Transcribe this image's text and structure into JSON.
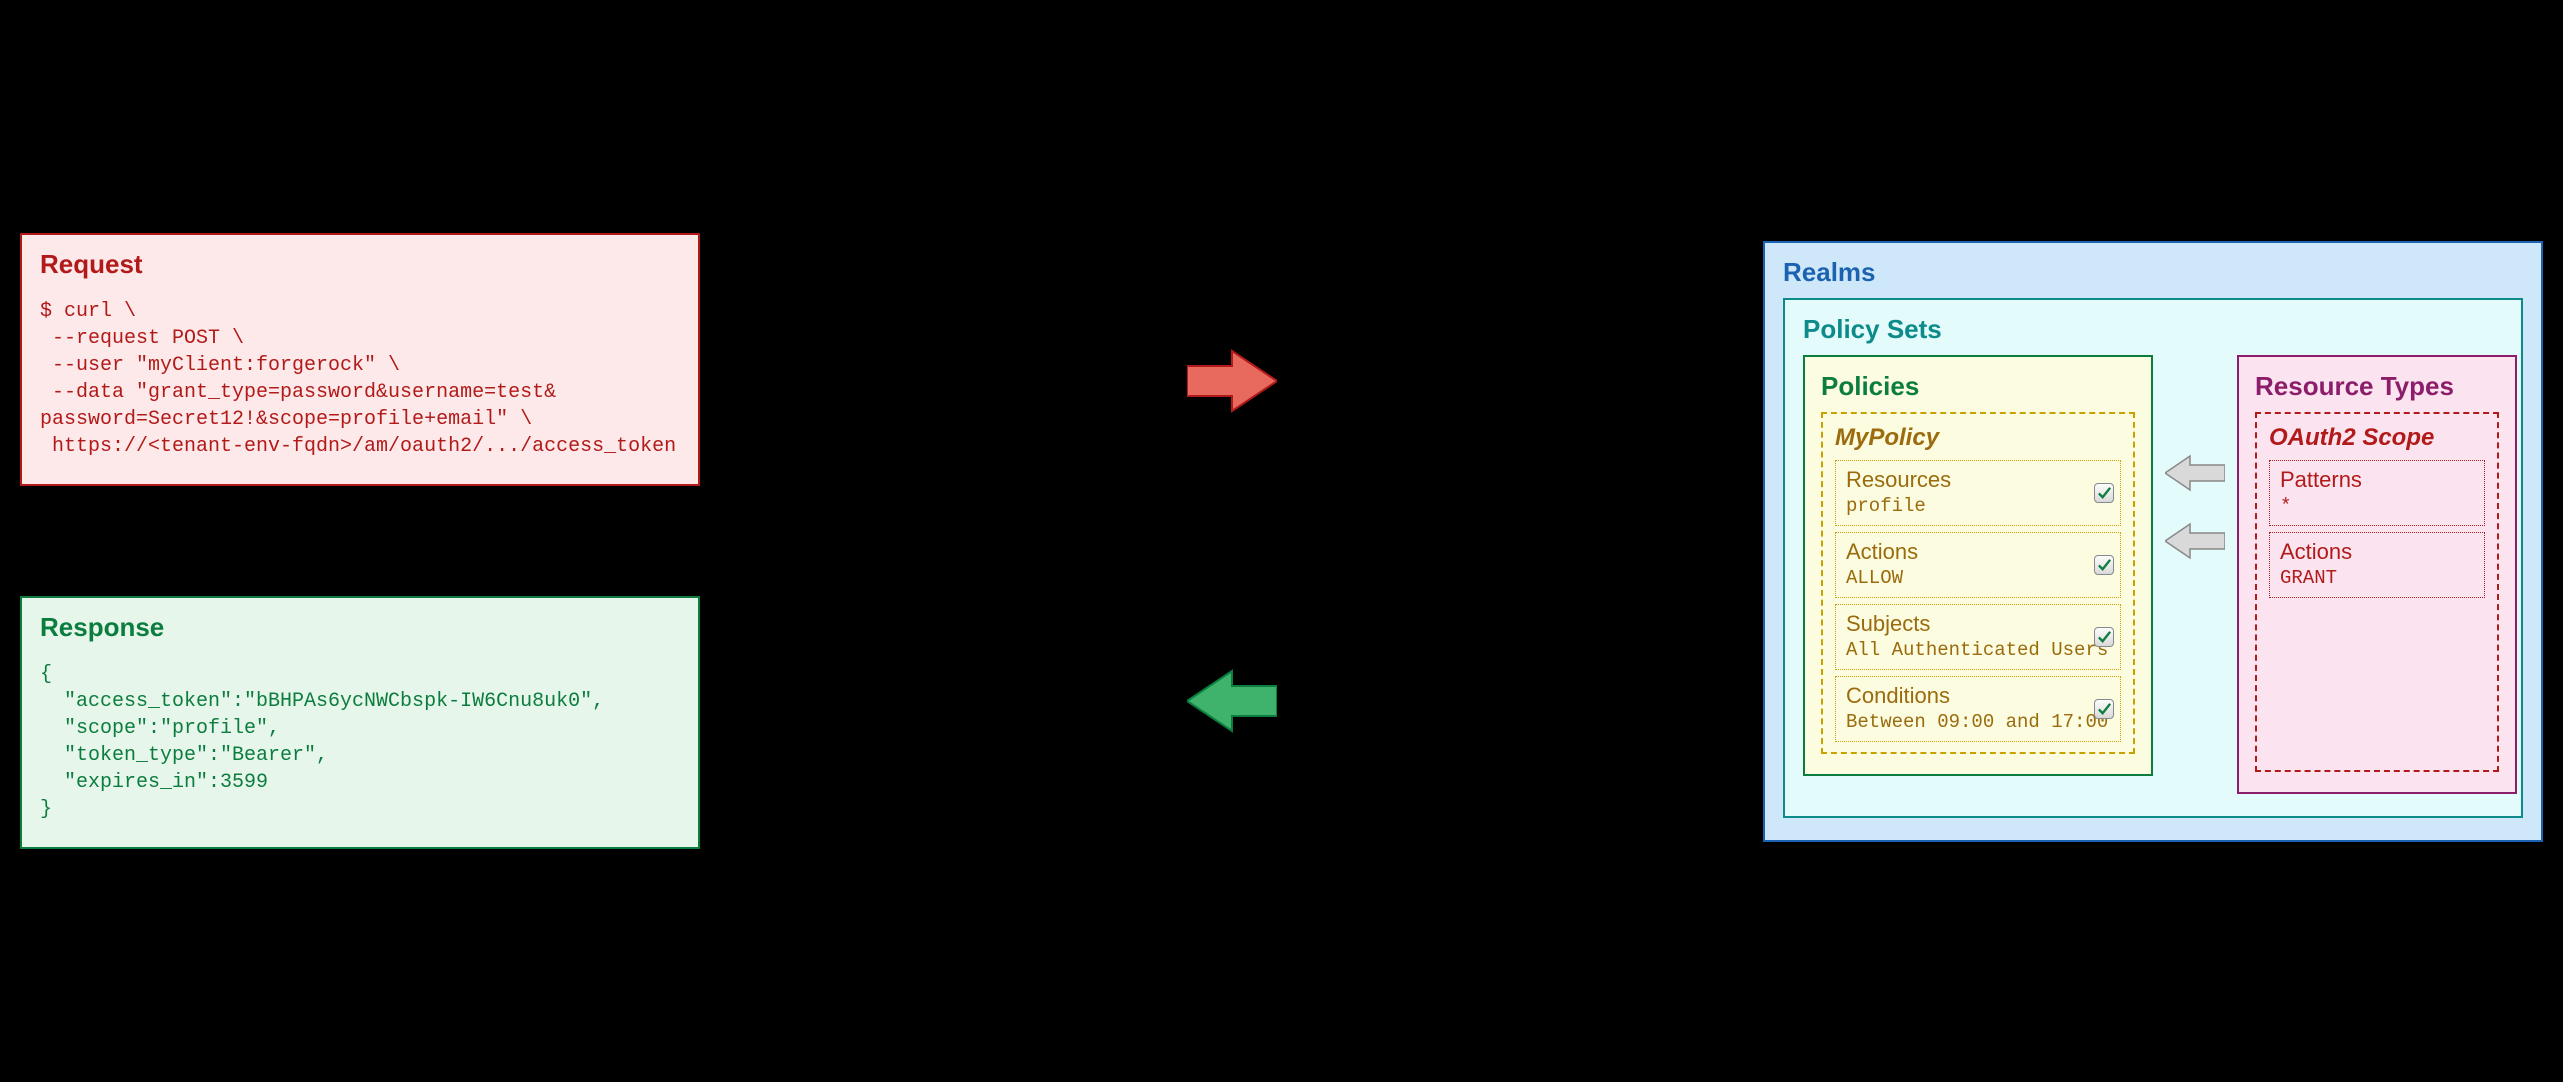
{
  "request": {
    "title": "Request",
    "code": "$ curl \\\n --request POST \\\n --user \"myClient:forgerock\" \\\n --data \"grant_type=password&username=test&\npassword=Secret12!&scope=profile+email\" \\\n https://<tenant-env-fqdn>/am/oauth2/.../access_token"
  },
  "response": {
    "title": "Response",
    "code": "{\n  \"access_token\":\"bBHPAs6ycNWCbspk-IW6Cnu8uk0\",\n  \"scope\":\"profile\",\n  \"token_type\":\"Bearer\",\n  \"expires_in\":3599\n}"
  },
  "realms": {
    "title": "Realms",
    "policy_sets": {
      "title": "Policy Sets",
      "policies": {
        "title": "Policies",
        "policy_name": "MyPolicy",
        "sections": {
          "resources": {
            "label": "Resources",
            "value": "profile"
          },
          "actions": {
            "label": "Actions",
            "value": "ALLOW"
          },
          "subjects": {
            "label": "Subjects",
            "value": "All Authenticated Users"
          },
          "conditions": {
            "label": "Conditions",
            "value": "Between 09:00 and 17:00"
          }
        }
      },
      "resource_types": {
        "title": "Resource Types",
        "scope_name": "OAuth2 Scope",
        "patterns": {
          "label": "Patterns",
          "value": "*"
        },
        "actions": {
          "label": "Actions",
          "value": "GRANT"
        }
      }
    }
  }
}
